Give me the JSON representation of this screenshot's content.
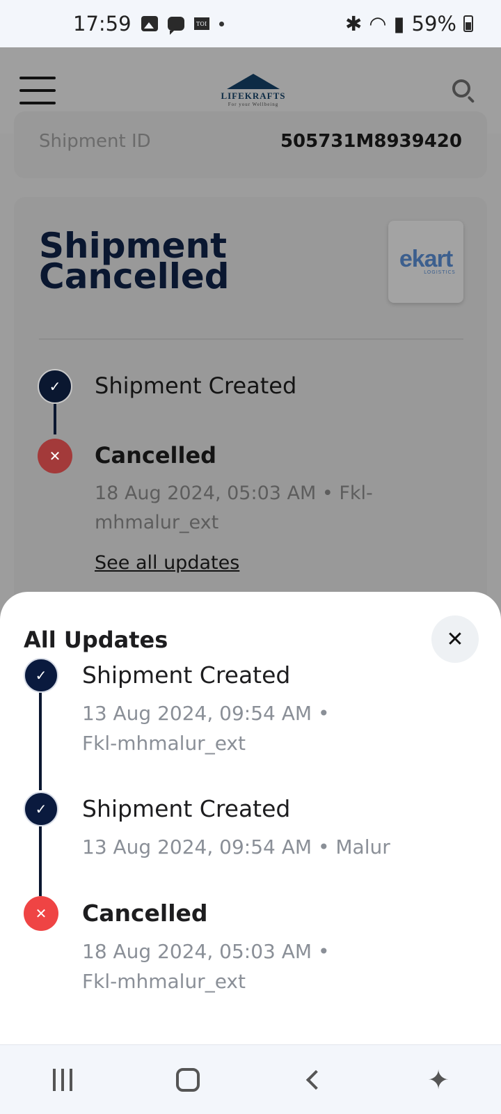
{
  "status_bar": {
    "time": "17:59",
    "battery": "59%"
  },
  "header": {
    "logo_title": "LIFEKRAFTS",
    "logo_tagline": "For your Wellbeing"
  },
  "shipment": {
    "id_label": "Shipment ID",
    "id_value": "505731M8939420"
  },
  "status_card": {
    "title": "Shipment Cancelled",
    "carrier_name": "ekart",
    "carrier_sub": "LOGISTICS",
    "events": [
      {
        "title": "Shipment Created",
        "state": "done"
      },
      {
        "title": "Cancelled",
        "state": "cancelled",
        "meta": "18 Aug 2024, 05:03 AM • Fkl-mhmalur_ext"
      }
    ],
    "see_all_label": "See all updates"
  },
  "sheet": {
    "title": "All Updates",
    "close_symbol": "✕",
    "events": [
      {
        "title": "Shipment Created",
        "meta": "13 Aug 2024, 09:54 AM • Fkl-mhmalur_ext",
        "state": "done"
      },
      {
        "title": "Shipment Created",
        "meta": "13 Aug 2024, 09:54 AM • Malur",
        "state": "done"
      },
      {
        "title": "Cancelled",
        "meta": "18 Aug 2024, 05:03 AM • Fkl-mhmalur_ext",
        "state": "cancelled"
      }
    ]
  },
  "icons": {
    "check": "✓",
    "cross": "✕"
  }
}
